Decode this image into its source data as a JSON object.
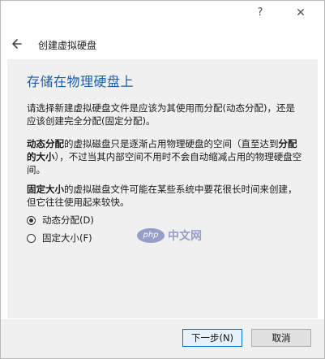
{
  "titlebar": {
    "help_label": "?",
    "close_label": "✕"
  },
  "header": {
    "title": "创建虚拟硬盘"
  },
  "page": {
    "title": "存储在物理硬盘上"
  },
  "paragraphs": {
    "p1": "请选择新建虚拟硬盘文件是应该为其使用而分配(动态分配)，还是应该创建完全分配(固定分配)。",
    "p2_bold1": "动态分配",
    "p2_text1": "的虚拟磁盘只是逐渐占用物理硬盘的空间（直至达到",
    "p2_bold2": "分配的大小",
    "p2_text2": "），不过当其内部空间不用时不会自动缩减占用的物理硬盘空间。",
    "p3_bold": "固定大小",
    "p3_text": "的虚拟磁盘文件可能在某些系统中要花很长时间来创建，但它往往使用起来较快。"
  },
  "options": [
    {
      "label": "动态分配(D)",
      "checked": true
    },
    {
      "label": "固定大小(F)",
      "checked": false
    }
  ],
  "buttons": {
    "next": "下一步(N)",
    "cancel": "取消"
  },
  "watermark": {
    "logo": "php",
    "text": "中文网"
  },
  "colors": {
    "accent": "#1c5fa8",
    "primary_button_border": "#0078d7"
  }
}
